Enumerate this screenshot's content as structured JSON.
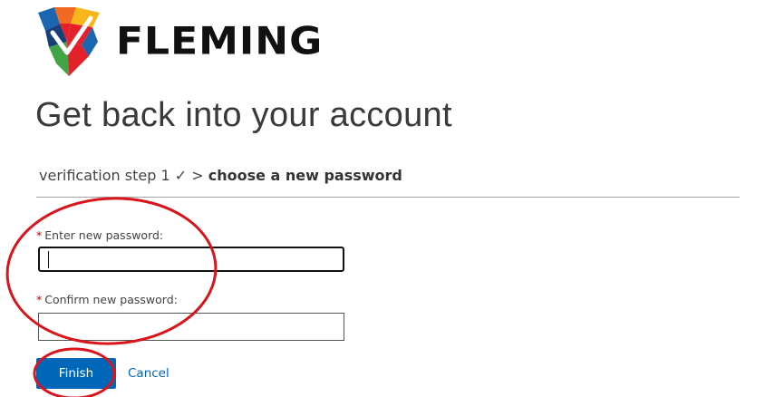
{
  "brand": {
    "name": "FLEMING",
    "logo_icon": "shield-checkmark-icon",
    "colors": {
      "red": "#e4202b",
      "orange": "#f26a21",
      "blue": "#1b66b1",
      "green": "#41a547",
      "navy": "#173f7a",
      "yellow": "#f7b718"
    }
  },
  "page": {
    "title": "Get back into your account"
  },
  "breadcrumb": {
    "step_done": "verification step 1 ✓ >",
    "current": "choose a new password"
  },
  "form": {
    "required_marker": "*",
    "new_password": {
      "label": "Enter new password:",
      "value": ""
    },
    "confirm_password": {
      "label": "Confirm new password:",
      "value": ""
    },
    "finish_label": "Finish",
    "cancel_label": "Cancel"
  },
  "colors": {
    "accent": "#0067b8",
    "annotation": "#d9141b"
  }
}
